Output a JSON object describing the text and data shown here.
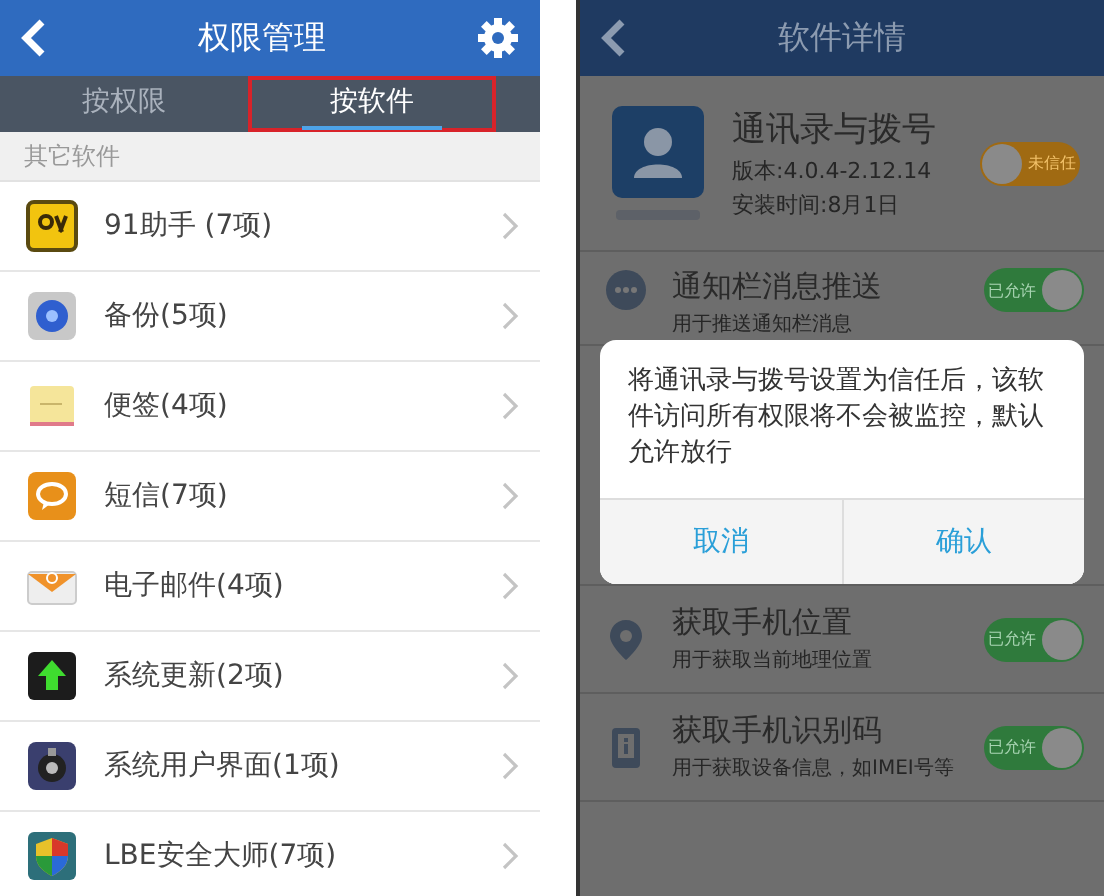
{
  "left": {
    "header": {
      "title": "权限管理"
    },
    "tabs": [
      {
        "label": "按权限",
        "selected": false,
        "highlighted": false
      },
      {
        "label": "按软件",
        "selected": true,
        "highlighted": true
      }
    ],
    "section_label": "其它软件",
    "apps": [
      {
        "name": "91助手 (7项)",
        "kind": "helper"
      },
      {
        "name": "备份(5项)",
        "kind": "backup"
      },
      {
        "name": "便签(4项)",
        "kind": "notes"
      },
      {
        "name": "短信(7项)",
        "kind": "sms"
      },
      {
        "name": "电子邮件(4项)",
        "kind": "email"
      },
      {
        "name": "系统更新(2项)",
        "kind": "update"
      },
      {
        "name": "系统用户界面(1项)",
        "kind": "systemui"
      },
      {
        "name": "LBE安全大师(7项)",
        "kind": "shield"
      }
    ]
  },
  "right": {
    "header": {
      "title": "软件详情"
    },
    "app": {
      "name": "通讯录与拨号",
      "version": "版本:4.0.4-2.12.14",
      "install_time": "安装时间:8月1日",
      "toggle": {
        "label": "未信任",
        "on": false
      }
    },
    "permissions": [
      {
        "title": "通知栏消息推送",
        "subtitle": "用于推送通知栏消息",
        "kind": "chat",
        "hidden_below": true,
        "toggle": {
          "label": "已允许",
          "on": true
        }
      },
      {
        "title": "获取手机位置",
        "subtitle": "用于获取当前地理位置",
        "kind": "location",
        "hidden_below": false,
        "toggle": {
          "label": "已允许",
          "on": true
        }
      },
      {
        "title": "获取手机识别码",
        "subtitle": "用于获取设备信息，如IMEI号等",
        "kind": "device",
        "hidden_below": false,
        "toggle": {
          "label": "已允许",
          "on": true
        }
      }
    ],
    "dialog": {
      "message": "将通讯录与拨号设置为信任后，该软件访问所有权限将不会被监控，默认允许放行",
      "buttons": [
        "取消",
        "确认"
      ]
    }
  }
}
